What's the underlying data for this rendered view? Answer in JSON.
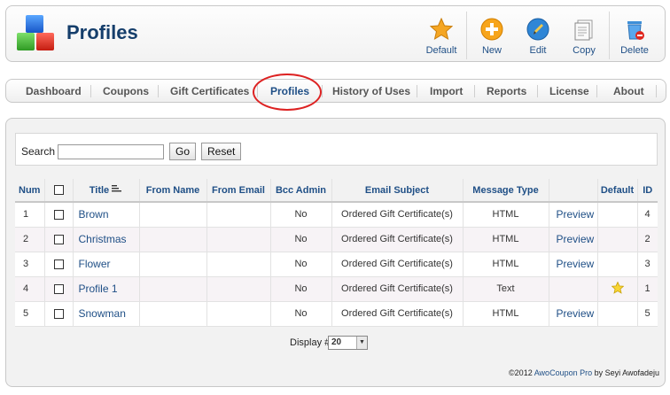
{
  "header": {
    "title": "Profiles",
    "toolbar": [
      {
        "label": "Default",
        "icon": "star-icon"
      },
      {
        "label": "New",
        "icon": "plus-icon"
      },
      {
        "label": "Edit",
        "icon": "pencil-icon"
      },
      {
        "label": "Copy",
        "icon": "copy-icon"
      },
      {
        "label": "Delete",
        "icon": "trash-icon"
      }
    ]
  },
  "nav": {
    "items": [
      "Dashboard",
      "Coupons",
      "Gift Certificates",
      "Profiles",
      "History of Uses",
      "Import",
      "Reports",
      "License",
      "About"
    ],
    "active": "Profiles"
  },
  "search": {
    "label": "Search",
    "value": "",
    "go_label": "Go",
    "reset_label": "Reset"
  },
  "table": {
    "headers": {
      "num": "Num",
      "title": "Title",
      "from_name": "From Name",
      "from_email": "From Email",
      "bcc_admin": "Bcc Admin",
      "email_subject": "Email Subject",
      "message_type": "Message Type",
      "default": "Default",
      "id": "ID"
    },
    "rows": [
      {
        "num": "1",
        "title": "Brown",
        "from_name": "",
        "from_email": "",
        "bcc": "No",
        "subject": "Ordered Gift Certificate(s)",
        "type": "HTML",
        "preview": "Preview",
        "id": "4"
      },
      {
        "num": "2",
        "title": "Christmas",
        "from_name": "",
        "from_email": "",
        "bcc": "No",
        "subject": "Ordered Gift Certificate(s)",
        "type": "HTML",
        "preview": "Preview",
        "id": "2"
      },
      {
        "num": "3",
        "title": "Flower",
        "from_name": "",
        "from_email": "",
        "bcc": "No",
        "subject": "Ordered Gift Certificate(s)",
        "type": "HTML",
        "preview": "Preview",
        "id": "3"
      },
      {
        "num": "4",
        "title": "Profile 1",
        "from_name": "",
        "from_email": "",
        "bcc": "No",
        "subject": "Ordered Gift Certificate(s)",
        "type": "Text",
        "preview": "",
        "id": "1"
      },
      {
        "num": "5",
        "title": "Snowman",
        "from_name": "",
        "from_email": "",
        "bcc": "No",
        "subject": "Ordered Gift Certificate(s)",
        "type": "HTML",
        "preview": "Preview",
        "id": "5"
      }
    ],
    "default_row": 3
  },
  "pagination": {
    "display_label": "Display #",
    "display_value": "20"
  },
  "footer": {
    "prefix": "©2012 ",
    "link": "AwoCoupon Pro",
    "suffix": " by Seyi Awofadeju"
  },
  "colors": {
    "accent": "#1f4f86",
    "title": "#153e6b",
    "highlight_circle": "#dd2222"
  }
}
